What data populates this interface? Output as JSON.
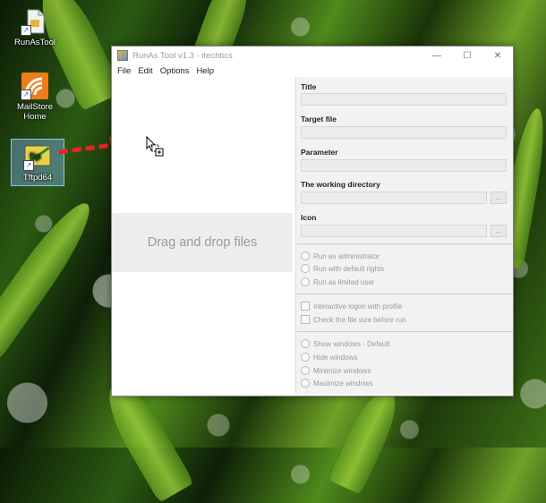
{
  "desktop": {
    "icons": [
      {
        "label": "RunAsTool"
      },
      {
        "label": "MailStore Home"
      },
      {
        "label": "Tftpd64"
      }
    ]
  },
  "window": {
    "title": "RunAs Tool v1.3 - itechtics",
    "menu": [
      "File",
      "Edit",
      "Options",
      "Help"
    ],
    "drop_zone_text": "Drag and drop files",
    "fields": [
      {
        "label": "Title",
        "value": ""
      },
      {
        "label": "Target file",
        "value": ""
      },
      {
        "label": "Parameter",
        "value": ""
      },
      {
        "label": "The working directory",
        "value": "",
        "browse": "..."
      },
      {
        "label": "Icon",
        "value": "",
        "browse": "..."
      }
    ],
    "run_options": [
      "Run as administrator",
      "Run with default rights",
      "Run as limited user"
    ],
    "checkboxes": [
      "Interactive logon with profile",
      "Check the file size before run"
    ],
    "window_options": [
      "Show windows - Default",
      "Hide windows",
      "Minimize windows",
      "Maximize windows"
    ]
  },
  "colors": {
    "drag_arrow": "#e8232a",
    "selection": "#78aae6"
  }
}
